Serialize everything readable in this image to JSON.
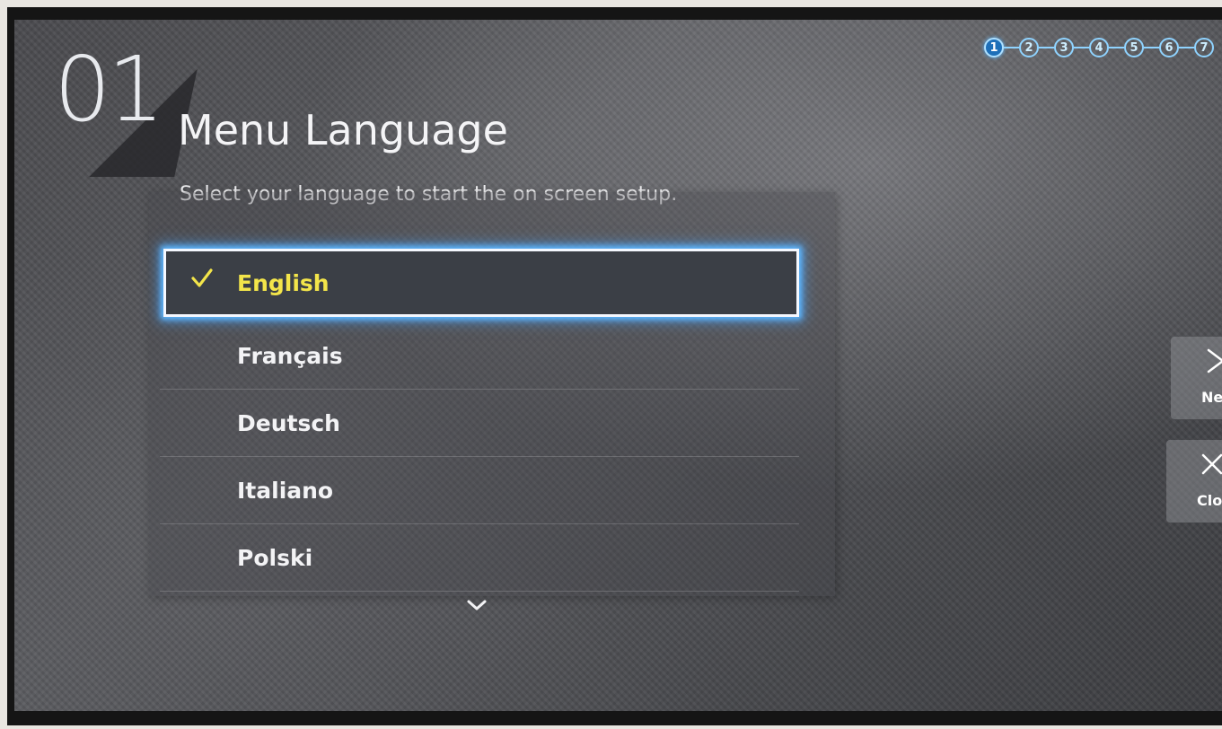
{
  "setup": {
    "step_number": "01",
    "title": "Menu Language",
    "subtitle": "Select your language to start the on screen setup.",
    "steps": [
      "1",
      "2",
      "3",
      "4",
      "5",
      "6",
      "7"
    ],
    "active_step": "1"
  },
  "languages": [
    {
      "label": "English",
      "selected": true
    },
    {
      "label": "Français",
      "selected": false
    },
    {
      "label": "Deutsch",
      "selected": false
    },
    {
      "label": "Italiano",
      "selected": false
    },
    {
      "label": "Polski",
      "selected": false
    }
  ],
  "buttons": {
    "next_label": "Ne",
    "close_label": "Clos"
  },
  "icons": {
    "check": "checkmark-icon",
    "scroll_down": "chevron-down-icon",
    "next": "next-icon",
    "close": "close-icon"
  },
  "colors": {
    "selected_text": "#f3e54a",
    "focus_glow": "#5fb8ff"
  }
}
